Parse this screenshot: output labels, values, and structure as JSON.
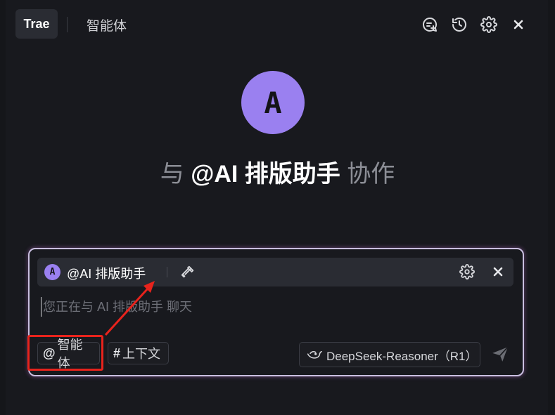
{
  "header": {
    "app_tab": "Trae",
    "agent_tab": "智能体",
    "icons": [
      "new-chat-icon",
      "history-icon",
      "settings-icon",
      "close-icon"
    ]
  },
  "hero": {
    "avatar_letter": "A",
    "prefix": "与",
    "agent_name": "@AI 排版助手",
    "suffix": "协作"
  },
  "composer": {
    "agent_chip": {
      "avatar_letter": "A",
      "name": "@AI 排版助手"
    },
    "placeholder": "您正在与 AI 排版助手 聊天",
    "value": "",
    "agent_button": {
      "symbol": "@",
      "label": "智能体"
    },
    "context_button": {
      "symbol": "#",
      "label": "上下文"
    },
    "model": {
      "name": "DeepSeek-Reasoner（R1）"
    }
  },
  "colors": {
    "background": "#18191e",
    "accent_avatar": "#9a80f0",
    "annotation_red": "#e8231c"
  }
}
